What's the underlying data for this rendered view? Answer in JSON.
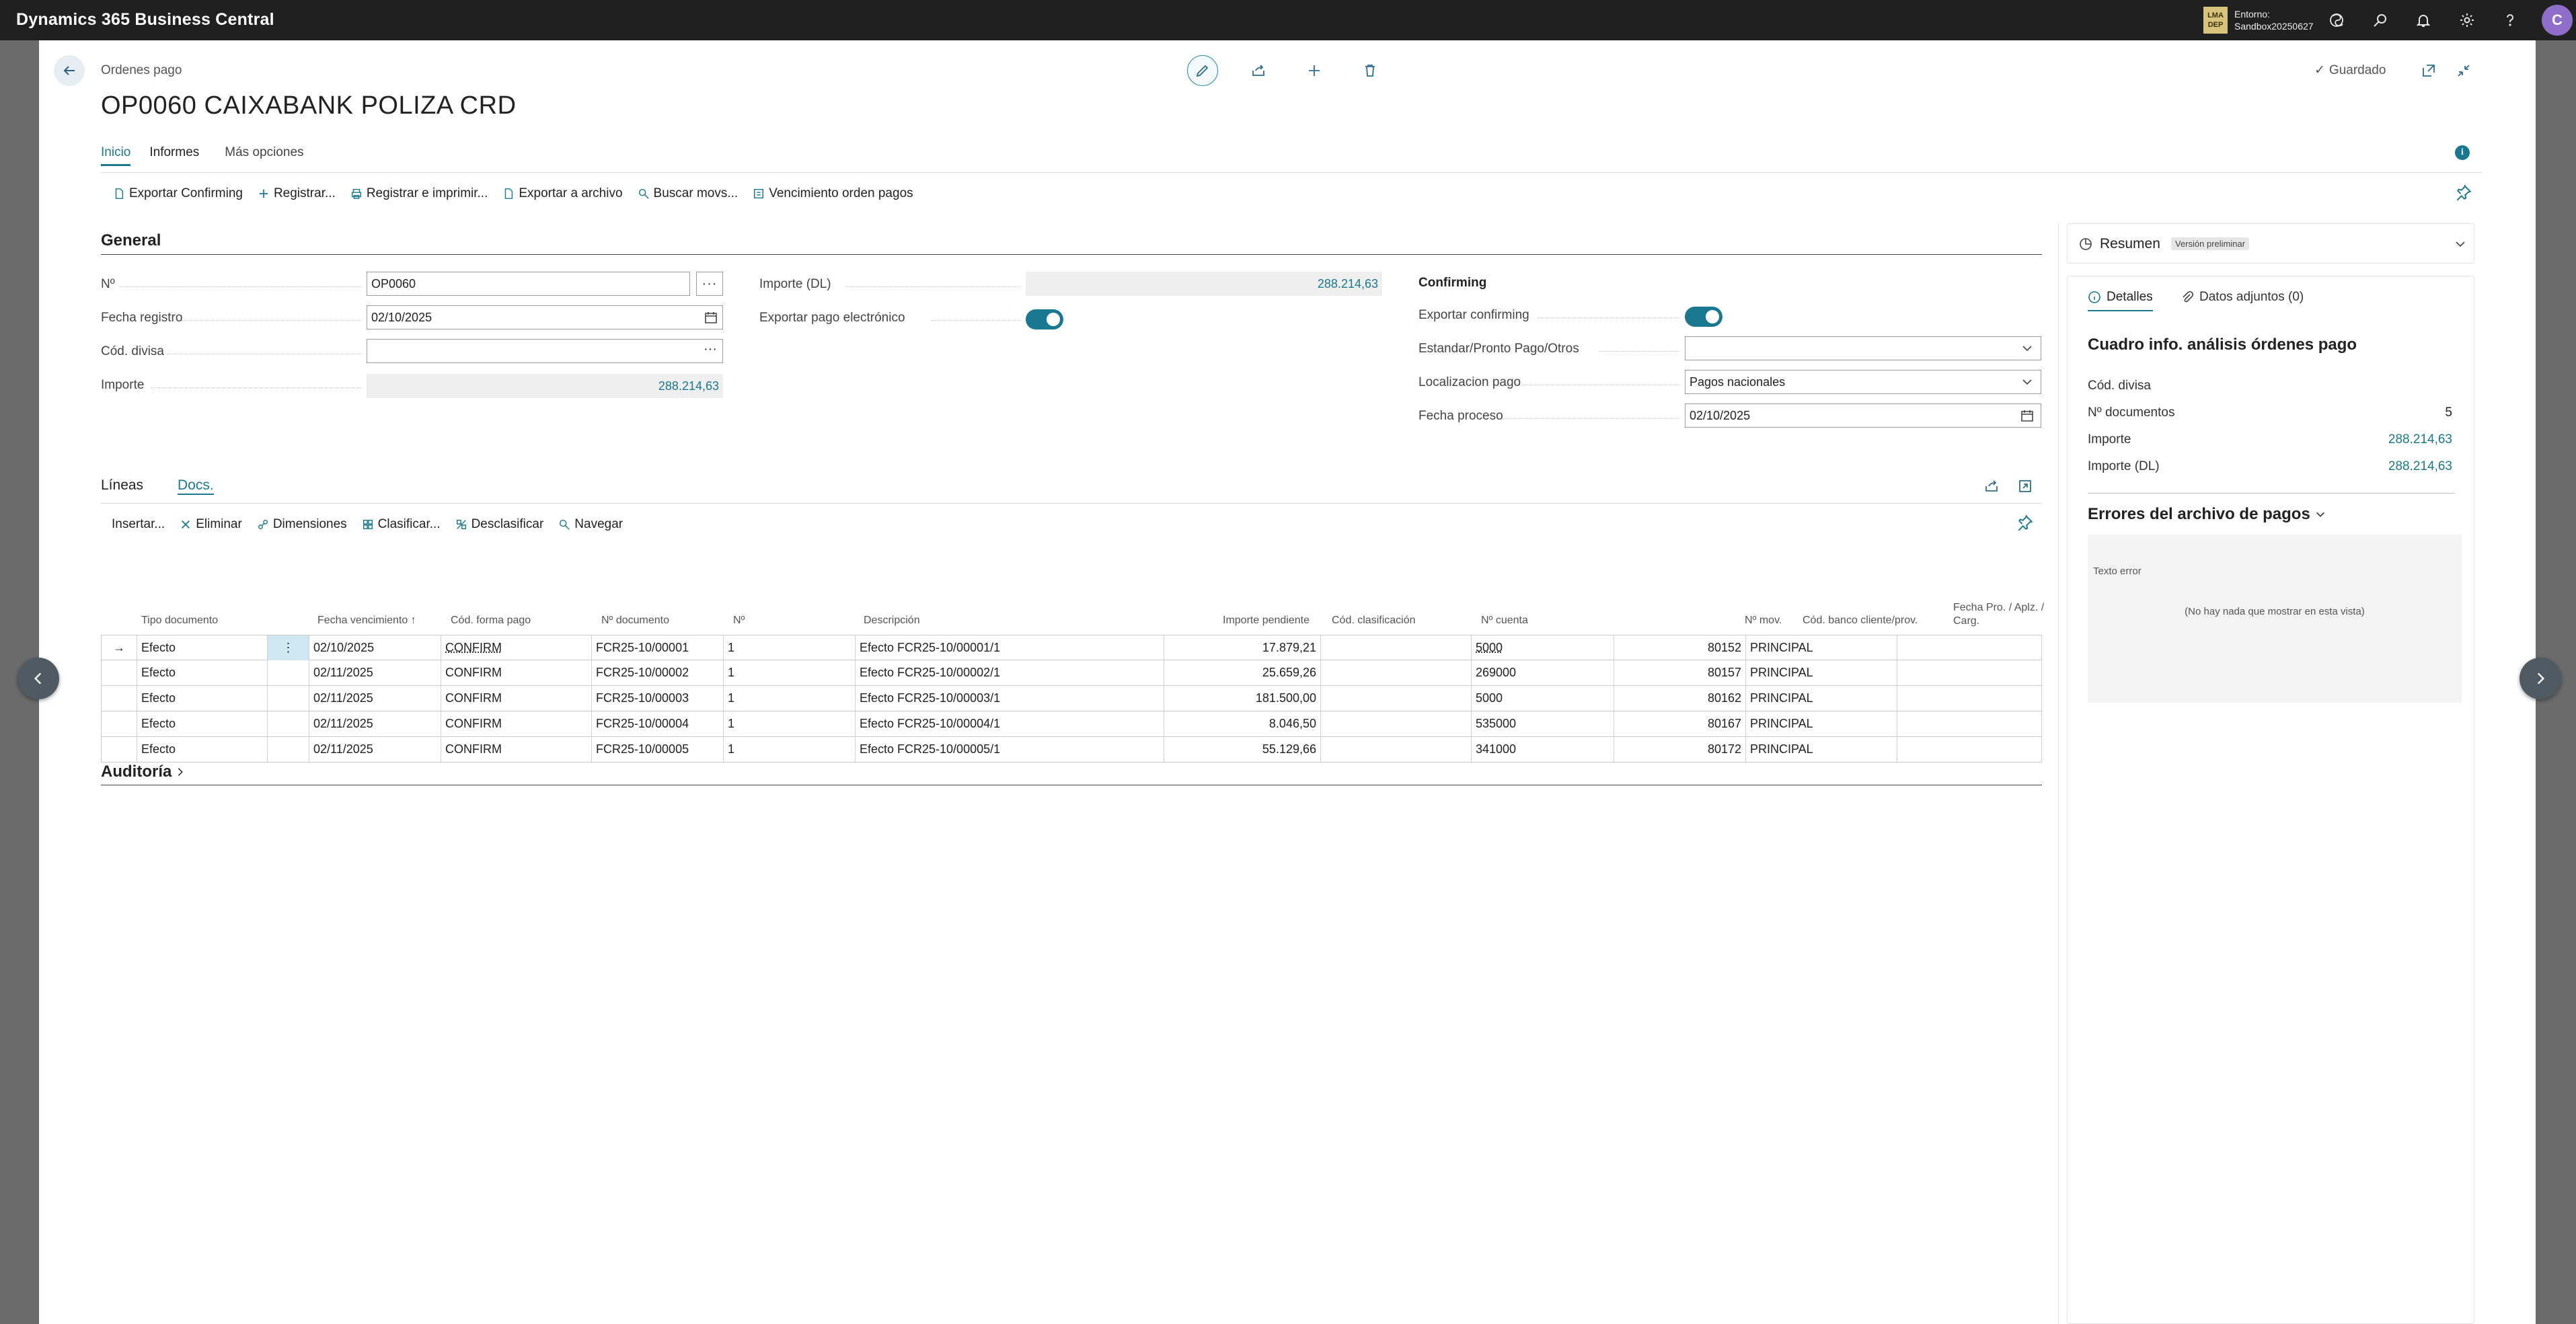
{
  "app": {
    "title": "Dynamics 365 Business Central"
  },
  "env": {
    "badge_line1": "LMA",
    "badge_line2": "DEP",
    "label": "Entorno:",
    "name": "Sandbox20250627"
  },
  "user": {
    "initial": "C"
  },
  "header": {
    "breadcrumb": "Ordenes pago",
    "title": "OP0060 CAIXABANK POLIZA CRD",
    "saved": "Guardado"
  },
  "tabs": {
    "inicio": "Inicio",
    "informes": "Informes",
    "mas": "Más opciones"
  },
  "actions": {
    "exportar_confirming": "Exportar Confirming",
    "registrar": "Registrar...",
    "registrar_imprimir": "Registrar e imprimir...",
    "exportar_archivo": "Exportar a archivo",
    "buscar_movs": "Buscar movs...",
    "vencimiento": "Vencimiento orden pagos"
  },
  "general": {
    "title": "General",
    "no_label": "Nº",
    "no_value": "OP0060",
    "fecha_registro_label": "Fecha registro",
    "fecha_registro_value": "02/10/2025",
    "cod_divisa_label": "Cód. divisa",
    "cod_divisa_value": "",
    "importe_label": "Importe",
    "importe_value": "288.214,63",
    "importe_dl_label": "Importe (DL)",
    "importe_dl_value": "288.214,63",
    "exportar_pago_label": "Exportar pago electrónico",
    "exportar_pago_on": true,
    "confirming_heading": "Confirming",
    "exportar_confirming_label": "Exportar confirming",
    "exportar_confirming_on": true,
    "estandar_label": "Estandar/Pronto Pago/Otros",
    "estandar_value": "",
    "localizacion_label": "Localizacion pago",
    "localizacion_value": "Pagos nacionales",
    "fecha_proceso_label": "Fecha proceso",
    "fecha_proceso_value": "02/10/2025"
  },
  "lines": {
    "tab_lineas": "Líneas",
    "tab_docs": "Docs.",
    "actions": {
      "insertar": "Insertar...",
      "eliminar": "Eliminar",
      "dimensiones": "Dimensiones",
      "clasificar": "Clasificar...",
      "desclasificar": "Desclasificar",
      "navegar": "Navegar"
    },
    "columns": {
      "tipo": "Tipo documento",
      "fecha": "Fecha vencimiento ↑",
      "forma": "Cód. forma pago",
      "ndoc": "Nº documento",
      "no": "Nº",
      "desc": "Descripción",
      "importe": "Importe pendiente",
      "clasif": "Cód. clasificación",
      "cuenta": "Nº cuenta",
      "mov": "Nº mov.",
      "banco": "Cód. banco cliente/prov.",
      "fecha_pro": "Fecha Pro. / Aplz. / Carg."
    },
    "rows": [
      {
        "tipo": "Efecto",
        "fecha": "02/10/2025",
        "forma": "CONFIRM",
        "ndoc": "FCR25-10/00001",
        "no": "1",
        "desc": "Efecto FCR25-10/00001/1",
        "importe": "17.879,21",
        "clasif": "",
        "cuenta": "5000",
        "mov": "80152",
        "banco": "PRINCIPAL",
        "fecha_pro": ""
      },
      {
        "tipo": "Efecto",
        "fecha": "02/11/2025",
        "forma": "CONFIRM",
        "ndoc": "FCR25-10/00002",
        "no": "1",
        "desc": "Efecto FCR25-10/00002/1",
        "importe": "25.659,26",
        "clasif": "",
        "cuenta": "269000",
        "mov": "80157",
        "banco": "PRINCIPAL",
        "fecha_pro": ""
      },
      {
        "tipo": "Efecto",
        "fecha": "02/11/2025",
        "forma": "CONFIRM",
        "ndoc": "FCR25-10/00003",
        "no": "1",
        "desc": "Efecto FCR25-10/00003/1",
        "importe": "181.500,00",
        "clasif": "",
        "cuenta": "5000",
        "mov": "80162",
        "banco": "PRINCIPAL",
        "fecha_pro": ""
      },
      {
        "tipo": "Efecto",
        "fecha": "02/11/2025",
        "forma": "CONFIRM",
        "ndoc": "FCR25-10/00004",
        "no": "1",
        "desc": "Efecto FCR25-10/00004/1",
        "importe": "8.046,50",
        "clasif": "",
        "cuenta": "535000",
        "mov": "80167",
        "banco": "PRINCIPAL",
        "fecha_pro": ""
      },
      {
        "tipo": "Efecto",
        "fecha": "02/11/2025",
        "forma": "CONFIRM",
        "ndoc": "FCR25-10/00005",
        "no": "1",
        "desc": "Efecto FCR25-10/00005/1",
        "importe": "55.129,66",
        "clasif": "",
        "cuenta": "341000",
        "mov": "80172",
        "banco": "PRINCIPAL",
        "fecha_pro": ""
      }
    ]
  },
  "auditoria": {
    "title": "Auditoría"
  },
  "factbox": {
    "title": "Resumen",
    "badge": "Versión preliminar",
    "tab_detalles": "Detalles",
    "tab_adjuntos": "Datos adjuntos (0)",
    "card_title": "Cuadro info. análisis órdenes pago",
    "cod_divisa_label": "Cód. divisa",
    "cod_divisa_value": "",
    "n_docs_label": "Nº documentos",
    "n_docs_value": "5",
    "importe_label": "Importe",
    "importe_value": "288.214,63",
    "importe_dl_label": "Importe (DL)",
    "importe_dl_value": "288.214,63",
    "errores_title": "Errores del archivo de pagos",
    "texto_error_header": "Texto error",
    "empty_text": "(No hay nada que mostrar en esta vista)"
  },
  "colors": {
    "accent": "#1a7891",
    "topbar": "#202020"
  }
}
